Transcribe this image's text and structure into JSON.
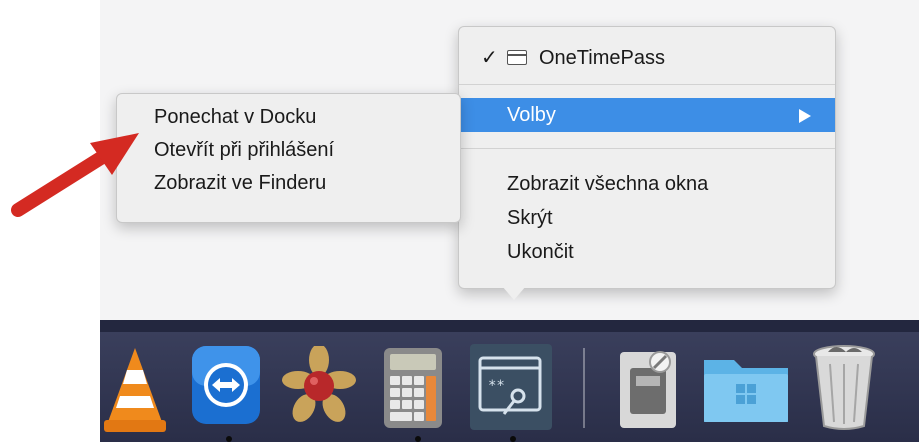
{
  "dock_menu": {
    "app_name": "OneTimePass",
    "app_checked": true,
    "options_label": "Volby",
    "items": [
      "Zobrazit všechna okna",
      "Skrýt",
      "Ukončit"
    ]
  },
  "options_submenu": {
    "items": [
      "Ponechat v Docku",
      "Otevřít při přihlášení",
      "Zobrazit ve Finderu"
    ]
  },
  "dock": {
    "apps": [
      "vlc-icon",
      "teamviewer-icon",
      "game-center-icon",
      "calculator-icon",
      "onetimepass-icon",
      "disk-utility-icon",
      "folder-icon",
      "trash-icon"
    ]
  },
  "colors": {
    "highlight": "#3d8ee6",
    "arrow": "#d42a22",
    "dock": "#2a2e48"
  }
}
